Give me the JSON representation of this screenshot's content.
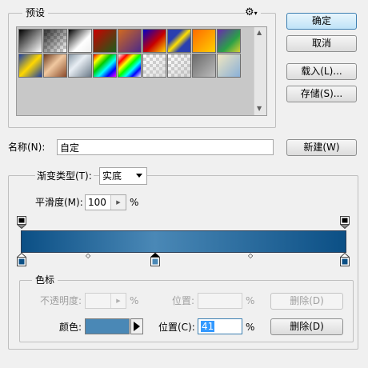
{
  "presets": {
    "title": "预设",
    "menu_icon": "gear-icon"
  },
  "buttons": {
    "ok": "确定",
    "cancel": "取消",
    "load": "载入(L)...",
    "save": "存储(S)...",
    "new": "新建(W)"
  },
  "name": {
    "label": "名称(N):",
    "value": "自定"
  },
  "gradient": {
    "type_label": "渐变类型(T):",
    "type_value": "实底",
    "smoothness_label": "平滑度(M):",
    "smoothness_value": "100",
    "smoothness_unit": "%"
  },
  "stops": {
    "title": "色标",
    "opacity_label": "不透明度:",
    "opacity_unit": "%",
    "opacity_location_label": "位置:",
    "opacity_location_unit": "%",
    "opacity_delete": "删除(D)",
    "color_label": "颜色:",
    "color_value": "#4a88b6",
    "location_label": "位置(C):",
    "location_value": "41",
    "location_unit": "%",
    "color_delete": "删除(D)"
  },
  "colors": {
    "gradient_dark": "#0b4f85",
    "gradient_light": "#4a88b6"
  }
}
